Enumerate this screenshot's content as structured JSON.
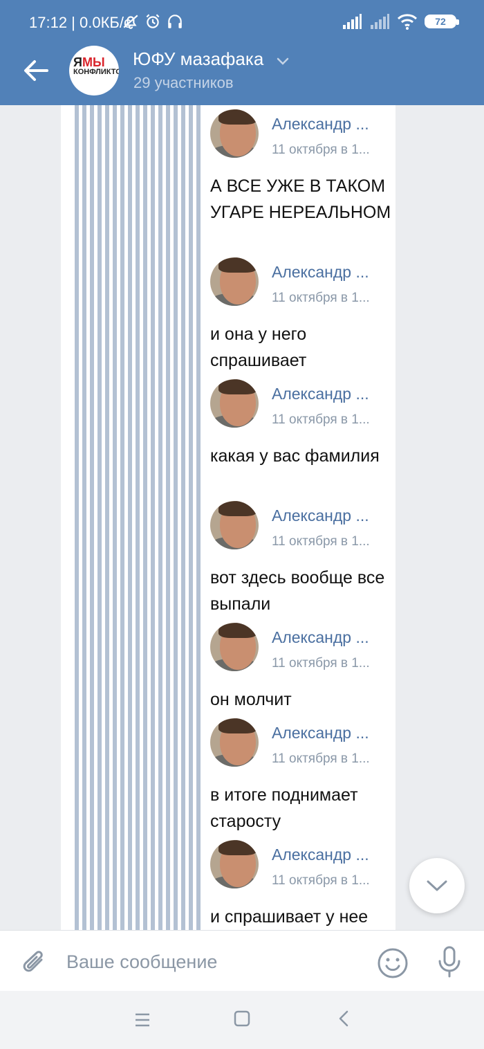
{
  "status_bar": {
    "time_speed": "17:12 | 0.0КБ/с",
    "battery": "72",
    "icons": [
      "bell-off-icon",
      "alarm-icon",
      "headphones-icon",
      "signal-icon",
      "signal-icon",
      "wifi-icon",
      "battery-icon"
    ]
  },
  "header": {
    "title": "ЮФУ мазафака",
    "subtitle": "29 участников",
    "avatar_logo": {
      "part1": "Я",
      "part2": "МЫ",
      "part3": "КОНФЛИКТО"
    },
    "colors": {
      "background": "#5181b8",
      "subtitle": "#c4d3e6"
    }
  },
  "messages": [
    {
      "name": "Александр ...",
      "date": "11 октября в 1...",
      "text": "А ВСЕ УЖЕ В ТАКОМ УГАРЕ НЕРЕАЛЬНОМ"
    },
    {
      "name": "Александр ...",
      "date": "11 октября в 1...",
      "text": "и она у него спрашивает"
    },
    {
      "name": "Александр ...",
      "date": "11 октября в 1...",
      "text": "какая у вас фамилия"
    },
    {
      "name": "Александр ...",
      "date": "11 октября в 1...",
      "text": "вот здесь вообще все выпали"
    },
    {
      "name": "Александр ...",
      "date": "11 октября в 1...",
      "text": "он молчит"
    },
    {
      "name": "Александр ...",
      "date": "11 октября в 1...",
      "text": "в итоге поднимает старосту"
    },
    {
      "name": "Александр ...",
      "date": "11 октября в 1...",
      "text": "и спрашивает у нее"
    }
  ],
  "composer": {
    "placeholder": "Ваше сообщение"
  },
  "colors": {
    "link_name": "#4a6fa0",
    "date": "#8a98a8",
    "stripes": "#b3c1d3",
    "page_bg": "#ebedf0"
  }
}
